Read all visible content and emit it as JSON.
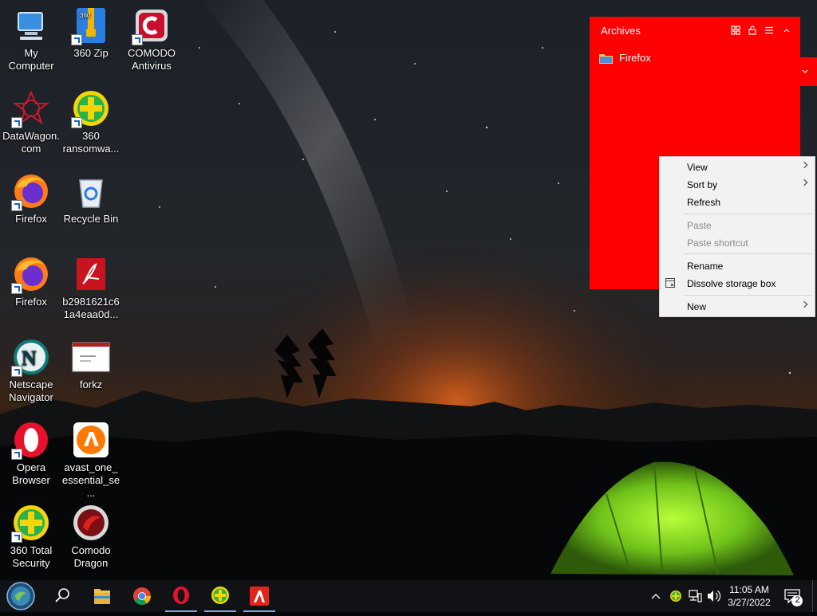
{
  "desktop": {
    "icons": [
      {
        "label": "My Computer"
      },
      {
        "label": "360 Zip"
      },
      {
        "label": "COMODO Antivirus"
      },
      {
        "label": "DataWagon.com"
      },
      {
        "label": "360 ransomwa..."
      },
      {
        "label": "Firefox"
      },
      {
        "label": "Recycle Bin"
      },
      {
        "label": "Firefox"
      },
      {
        "label": "b2981621c61a4eaa0d..."
      },
      {
        "label": "Netscape Navigator"
      },
      {
        "label": "forkz"
      },
      {
        "label": "Opera Browser"
      },
      {
        "label": "avast_one_essential_se..."
      },
      {
        "label": "360 Total Security"
      },
      {
        "label": "Comodo Dragon"
      }
    ]
  },
  "fence": {
    "title": "Archives",
    "color": "#ff0000",
    "items": [
      {
        "label": "Firefox"
      }
    ]
  },
  "context_menu": {
    "items": [
      {
        "label": "View"
      },
      {
        "label": "Sort by"
      },
      {
        "label": "Refresh"
      },
      {
        "label": "Paste"
      },
      {
        "label": "Paste shortcut"
      },
      {
        "label": "Rename"
      },
      {
        "label": "Dissolve storage box"
      },
      {
        "label": "New"
      }
    ]
  },
  "taskbar": {
    "time": "11:05 AM",
    "date": "3/27/2022",
    "notification_count": "2",
    "pinned": [
      "start-orb-icon",
      "search-icon",
      "file-explorer-icon",
      "chrome-icon",
      "opera-icon",
      "360-security-icon",
      "avira-icon"
    ]
  }
}
